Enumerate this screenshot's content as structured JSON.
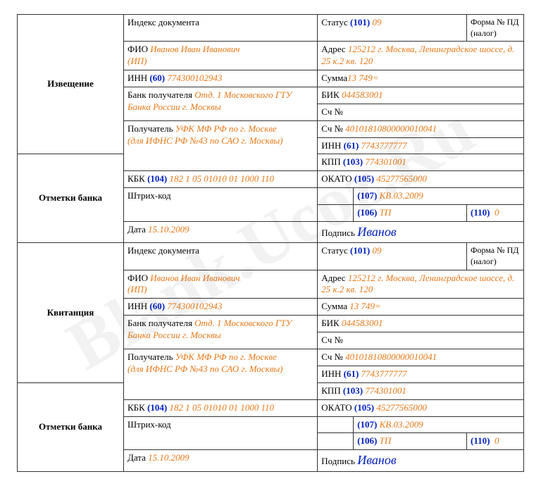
{
  "watermark": "Blank.Ucoz.Ru",
  "left": {
    "notice": "Извещение",
    "bankmarks": "Отметки банка",
    "receipt": "Квитанция"
  },
  "labels": {
    "docIndex": "Индекс документа",
    "status": "Статус",
    "formNo": "Форма № ПД (налог)",
    "fio": "ФИО",
    "ip": "(ИП)",
    "address": "Адрес",
    "inn": "ИНН",
    "sum": "Сумма",
    "bankRecv": "Банк получателя",
    "bik": "БИК",
    "acct": "Сч №",
    "recv": "Получатель",
    "recvNote": "(для ИФНС РФ №43 по САО г. Москвы)",
    "kpp": "КПП",
    "kbk": "КБК",
    "okato": "ОКАТО",
    "barcode": "Штрих-код",
    "date": "Дата",
    "signature": "Подпись"
  },
  "codes": {
    "status": "(101)",
    "inn": "(60)",
    "innRecv": "(61)",
    "kpp": "(103)",
    "kbk": "(104)",
    "okato": "(105)",
    "f106": "(106)",
    "f107": "(107)",
    "f110": "(110)"
  },
  "vals": {
    "status": "09",
    "fio": "Иванов Иван Иванович",
    "address": "125212 г. Москва, Ленинградское шоссе, д. 25 к.2 кв. 120",
    "inn": "774300102943",
    "sum": "13 749=",
    "bankRecv": "Отд. 1 Московского ГТУ Банка России г. Москвы",
    "bik": "044583001",
    "recv": "УФК МФ РФ по г. Москве",
    "acctRecv": "40101810800000010041",
    "innRecv": "7743777777",
    "kpp": "774301001",
    "kbk": "182 1 05 01010 01 1000 110",
    "okato": "45277565000",
    "f107": "КВ.03.2009",
    "f106": "ТП",
    "f110": "0",
    "date": "15.10.2009",
    "signature": "Иванов"
  }
}
